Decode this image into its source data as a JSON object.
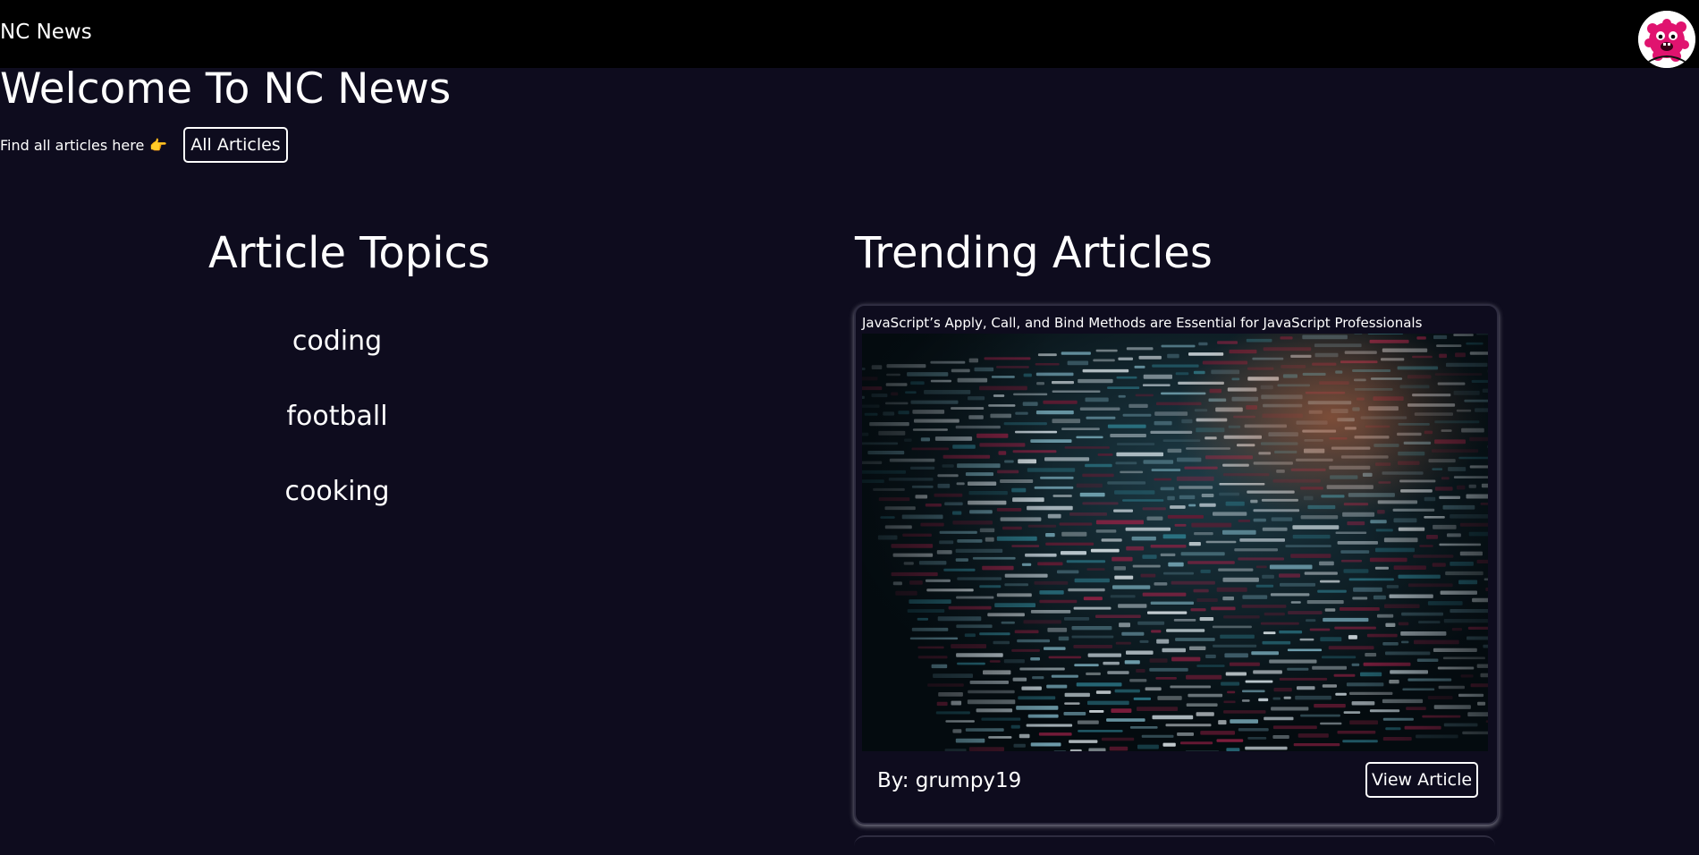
{
  "header": {
    "brand": "NC News",
    "avatar_icon": "pink-monster-avatar-icon"
  },
  "hero": {
    "title": "Welcome To NC News",
    "find_text": "Find all articles here",
    "find_emoji": "👉",
    "all_articles_label": "All Articles"
  },
  "topics": {
    "title": "Article Topics",
    "items": [
      {
        "label": "coding"
      },
      {
        "label": "football"
      },
      {
        "label": "cooking"
      }
    ]
  },
  "trending": {
    "title": "Trending Articles",
    "articles": [
      {
        "title": "JavaScript’s Apply, Call, and Bind Methods are Essential for JavaScript Professionals",
        "author": "By: grumpy19",
        "button_label": "View Article",
        "image_icon": "code-screen-photo"
      }
    ]
  },
  "colors": {
    "page_bg": "#0e0c1e",
    "header_bg": "#000000",
    "text": "#ffffff",
    "avatar_pink": "#e0136f"
  }
}
